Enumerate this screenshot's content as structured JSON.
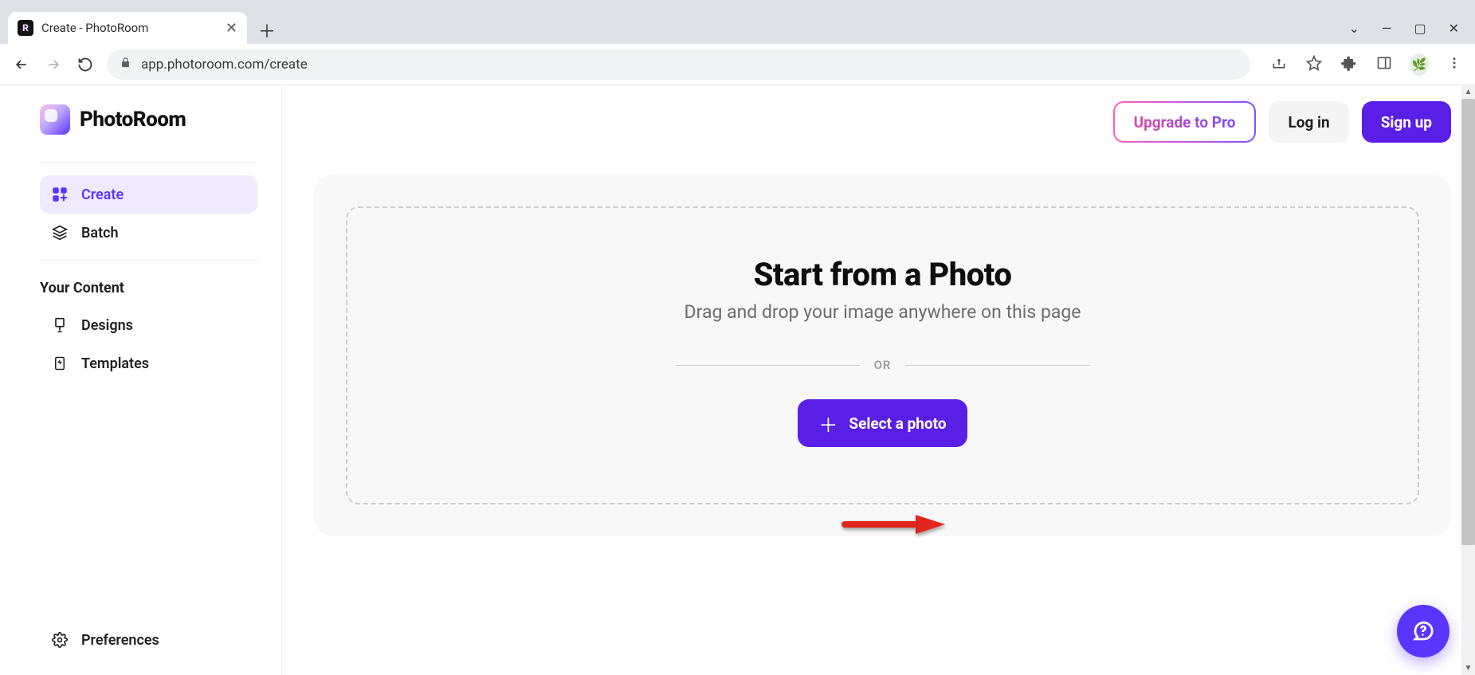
{
  "browser": {
    "tab_title": "Create - PhotoRoom",
    "url": "app.photoroom.com/create"
  },
  "app": {
    "logo_text": "PhotoRoom",
    "sidebar": {
      "items": [
        {
          "label": "Create"
        },
        {
          "label": "Batch"
        }
      ],
      "section_label": "Your Content",
      "content_items": [
        {
          "label": "Designs"
        },
        {
          "label": "Templates"
        }
      ],
      "preferences_label": "Preferences"
    },
    "topbar": {
      "upgrade_label": "Upgrade to Pro",
      "login_label": "Log in",
      "signup_label": "Sign up"
    },
    "dropzone": {
      "title": "Start from a Photo",
      "subtitle": "Drag and drop your image anywhere on this page",
      "or_label": "OR",
      "select_label": "Select a photo"
    }
  },
  "colors": {
    "brand_purple": "#5a1fe6",
    "brand_violet": "#5a34ff",
    "annotation_red": "#e1261c"
  }
}
